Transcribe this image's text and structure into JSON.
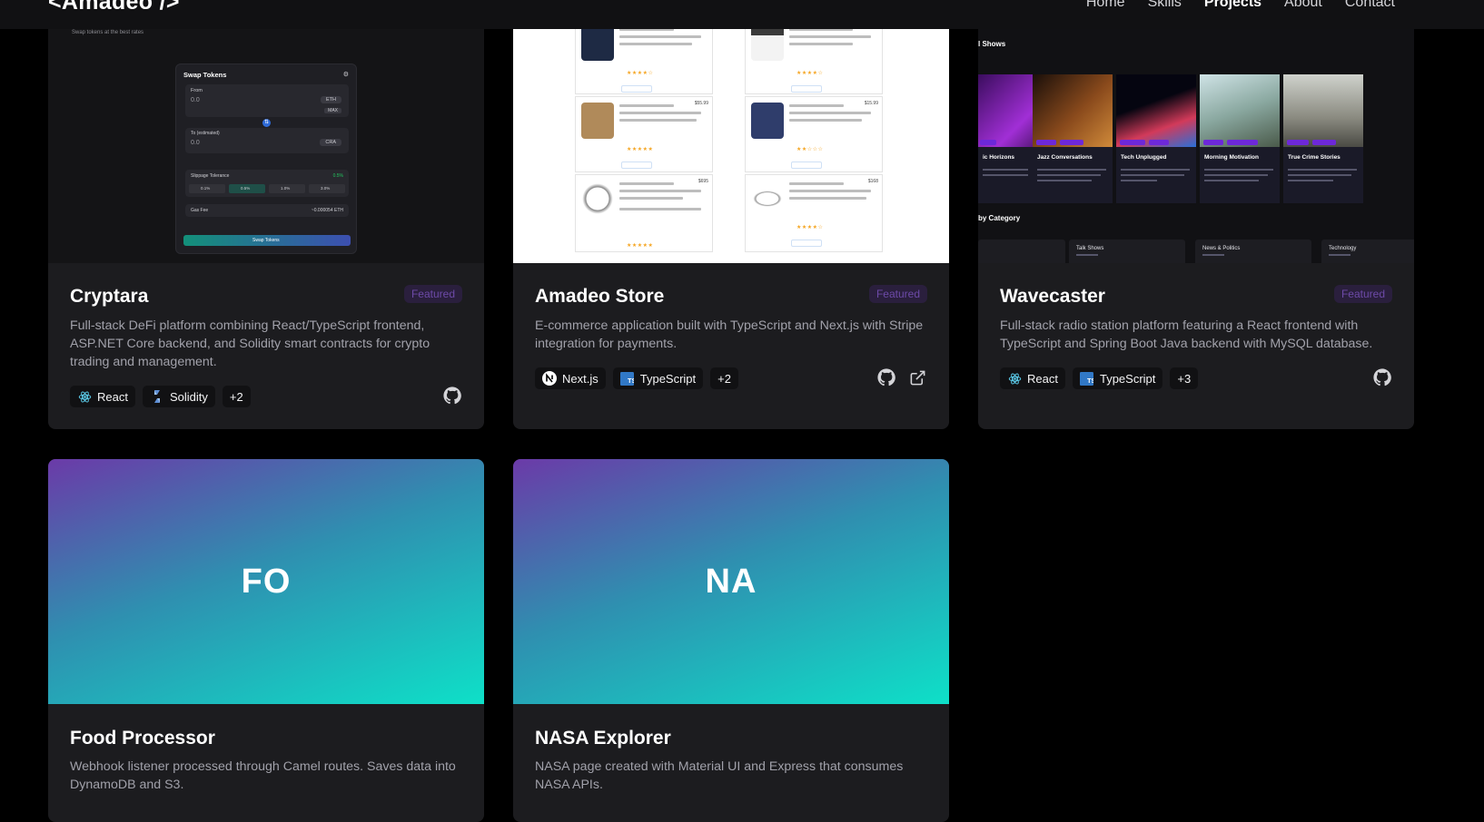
{
  "header": {
    "logo": "<Amadeo />",
    "nav": [
      "Home",
      "Skills",
      "Projects",
      "About",
      "Contact"
    ],
    "active_nav": "Projects"
  },
  "projects": [
    {
      "title": "Cryptara",
      "badge": "Featured",
      "description": "Full-stack DeFi platform combining React/TypeScript frontend, ASP.NET Core backend, and Solidity smart contracts for crypto trading and management.",
      "tags": [
        {
          "label": "React",
          "icon": "react-icon"
        },
        {
          "label": "Solidity",
          "icon": "solidity-icon"
        },
        {
          "label": "+2"
        }
      ],
      "preview": {
        "subtitle": "Swap tokens at the best rates",
        "panel_title": "Swap Tokens",
        "from_label": "From",
        "from_value": "0.0",
        "from_token": "ETH",
        "max": "MAX",
        "to_label": "To (estimated)",
        "to_value": "0.0",
        "to_token": "CRA",
        "slippage_label": "Slippage Tolerance",
        "slippage_value": "0.5%",
        "slippage_options": [
          "0.1%",
          "0.5%",
          "1.0%",
          "3.0%"
        ],
        "gas_label": "Gas Fee",
        "gas_value": "~0.000054 ETH",
        "button": "Swap Tokens"
      }
    },
    {
      "title": "Amadeo Store",
      "badge": "Featured",
      "description": "E-commerce application built with TypeScript and Next.js with Stripe integration for payments.",
      "tags": [
        {
          "label": "Next.js",
          "icon": "nextjs-icon"
        },
        {
          "label": "TypeScript",
          "icon": "typescript-icon"
        },
        {
          "label": "+2"
        }
      ],
      "preview": {
        "prices": [
          "$109.95",
          "$22.3",
          "$55.99",
          "$15.99",
          "$695",
          "$168"
        ]
      }
    },
    {
      "title": "Wavecaster",
      "badge": "Featured",
      "description": "Full-stack radio station platform featuring a React frontend with TypeScript and Spring Boot Java backend with MySQL database.",
      "tags": [
        {
          "label": "React",
          "icon": "react-icon"
        },
        {
          "label": "TypeScript",
          "icon": "typescript-icon"
        },
        {
          "label": "+3"
        }
      ],
      "preview": {
        "section_shows": "l Shows",
        "shows": [
          "ic Horizons",
          "Jazz Conversations",
          "Tech Unplugged",
          "Morning Motivation",
          "True Crime Stories"
        ],
        "section_category": "by Category",
        "categories": [
          "Talk Shows",
          "News & Politics",
          "Technology"
        ]
      }
    },
    {
      "title": "Food Processor",
      "initials": "FO",
      "description": "Webhook listener processed through Camel routes. Saves data into DynamoDB and S3."
    },
    {
      "title": "NASA Explorer",
      "initials": "NA",
      "description": "NASA page created with Material UI and Express that consumes NASA APIs."
    }
  ],
  "colors": {
    "background": "#000000",
    "card": "#1c1c1f",
    "badge_text": "#6d4aa8",
    "gradient_start": "#6b3aa8",
    "gradient_end": "#0ee0c8"
  }
}
